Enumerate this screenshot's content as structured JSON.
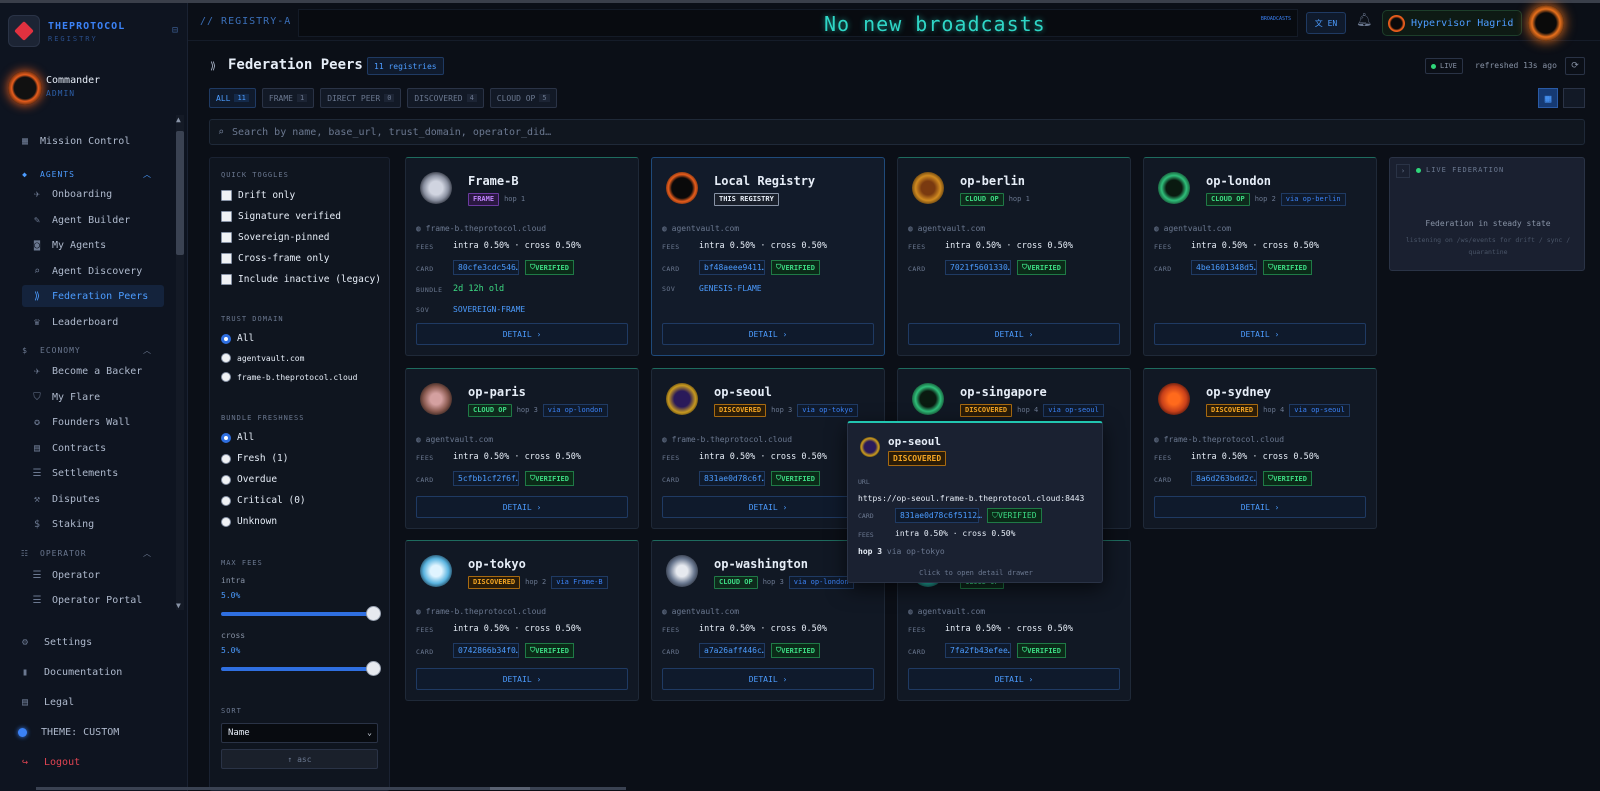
{
  "brand": {
    "name": "THEPROTOCOL",
    "sub": "REGISTRY"
  },
  "user": {
    "name": "Commander",
    "role": "ADMIN"
  },
  "nav": {
    "mission": "Mission Control",
    "agents_sec": "AGENTS",
    "onboarding": "Onboarding",
    "builder": "Agent Builder",
    "my_agents": "My Agents",
    "discovery": "Agent Discovery",
    "federation": "Federation Peers",
    "leaderboard": "Leaderboard",
    "economy_sec": "ECONOMY",
    "backer": "Become a Backer",
    "flare": "My Flare",
    "founders": "Founders Wall",
    "contracts": "Contracts",
    "settlements": "Settlements",
    "disputes": "Disputes",
    "staking": "Staking",
    "operator_sec": "OPERATOR",
    "operator": "Operator",
    "portal": "Operator Portal",
    "settings": "Settings",
    "docs": "Documentation",
    "legal": "Legal",
    "theme": "THEME: CUSTOM",
    "logout": "Logout"
  },
  "header": {
    "crumb": "// REGISTRY-A",
    "ticker": "No new broadcasts",
    "ticker_tag": "BROADCASTS",
    "lang": "文 EN",
    "user": "Hypervisor Hagrid"
  },
  "page": {
    "title": "Federation Peers",
    "count": "11 registries",
    "live": "LIVE",
    "refreshed": "refreshed 13s ago"
  },
  "tabs": [
    {
      "label": "ALL",
      "n": "11"
    },
    {
      "label": "FRAME",
      "n": "1"
    },
    {
      "label": "DIRECT PEER",
      "n": "0"
    },
    {
      "label": "DISCOVERED",
      "n": "4"
    },
    {
      "label": "CLOUD OP",
      "n": "5"
    }
  ],
  "search": {
    "placeholder": "Search by name, base_url, trust_domain, operator_did…"
  },
  "filters": {
    "quick": "QUICK TOGGLES",
    "drift": "Drift only",
    "sig": "Signature verified",
    "sov": "Sovereign-pinned",
    "cross": "Cross-frame only",
    "inactive": "Include inactive (legacy)",
    "trust": "TRUST DOMAIN",
    "t_all": "All",
    "t_av": "agentvault.com",
    "t_fb": "frame-b.theprotocol.cloud",
    "bundle": "BUNDLE FRESHNESS",
    "b_all": "All",
    "b_fresh": "Fresh (1)",
    "b_over": "Overdue",
    "b_crit": "Critical (0)",
    "b_unk": "Unknown",
    "maxfees": "MAX FEES",
    "intra": "intra",
    "intra_val": "5.0%",
    "cross_lab": "cross",
    "cross_val": "5.0%",
    "intra_level": 1.0,
    "cross_level": 1.0,
    "sort": "SORT",
    "sort_val": "Name",
    "asc": "↑ asc"
  },
  "cards": [
    {
      "name": "Frame-B",
      "tag": "FRAME",
      "hop": "hop 1",
      "via": "",
      "host": "frame-b.theprotocol.cloud",
      "fees": "intra 0.50% · cross 0.50%",
      "card": "80cfe3cdc546…",
      "verified": "VERIFIED",
      "bundle": "2d 12h old",
      "sov": "SOVEREIGN-FRAME"
    },
    {
      "name": "Local Registry",
      "tag": "THIS REGISTRY",
      "hop": "",
      "via": "",
      "host": "agentvault.com",
      "fees": "intra 0.50% · cross 0.50%",
      "card": "bf48aeee9411…",
      "verified": "VERIFIED",
      "sov": "GENESIS-FLAME"
    },
    {
      "name": "op-berlin",
      "tag": "CLOUD OP",
      "hop": "hop 1",
      "via": "",
      "host": "agentvault.com",
      "fees": "intra 0.50% · cross 0.50%",
      "card": "7021f5601330…",
      "verified": "VERIFIED"
    },
    {
      "name": "op-london",
      "tag": "CLOUD OP",
      "hop": "hop 2",
      "via": "via op-berlin",
      "host": "agentvault.com",
      "fees": "intra 0.50% · cross 0.50%",
      "card": "4be1601348d5…",
      "verified": "VERIFIED"
    },
    {
      "name": "op-paris",
      "tag": "CLOUD OP",
      "hop": "hop 3",
      "via": "via op-london",
      "host": "agentvault.com",
      "fees": "intra 0.50% · cross 0.50%",
      "card": "5cfbb1cf2f6f…",
      "verified": "VERIFIED"
    },
    {
      "name": "op-seoul",
      "tag": "DISCOVERED",
      "hop": "hop 3",
      "via": "via op-tokyo",
      "host": "frame-b.theprotocol.cloud",
      "fees": "intra 0.50% · cross 0.50%",
      "card": "831ae0d78c6f…",
      "verified": "VERIFIED"
    },
    {
      "name": "op-singapore",
      "tag": "DISCOVERED",
      "hop": "hop 4",
      "via": "via op-seoul"
    },
    {
      "name": "op-sydney",
      "tag": "DISCOVERED",
      "hop": "hop 4",
      "via": "via op-seoul",
      "host": "frame-b.theprotocol.cloud",
      "fees": "intra 0.50% · cross 0.50%",
      "card": "8a6d263bdd2c…",
      "verified": "VERIFIED"
    },
    {
      "name": "op-tokyo",
      "tag": "DISCOVERED",
      "hop": "hop 2",
      "via": "via Frame-B",
      "host": "frame-b.theprotocol.cloud",
      "fees": "intra 0.50% · cross 0.50%",
      "card": "0742866b34f0…",
      "verified": "VERIFIED"
    },
    {
      "name": "op-washington",
      "tag": "CLOUD OP",
      "hop": "hop 3",
      "via": "via op-london",
      "host": "agentvault.com",
      "fees": "intra 0.50% · cross 0.50%",
      "card": "a7a26aff446c…",
      "verified": "VERIFIED"
    },
    {
      "name": "",
      "tag": "CLOUD OP",
      "hop": "",
      "via": "",
      "host": "agentvault.com",
      "fees": "intra 0.50% · cross 0.50%",
      "card": "7fa2fb43efee…",
      "verified": "VERIFIED"
    }
  ],
  "labels": {
    "fees": "FEES",
    "card": "CARD",
    "bundle": "BUNDLE",
    "sov": "SOV",
    "detail": "DETAIL ›"
  },
  "livefed": {
    "title": "LIVE FEDERATION",
    "main": "Federation in steady state",
    "sub": "listening on /ws/events for drift / sync / quarantine"
  },
  "tooltip": {
    "name": "op-seoul",
    "tag": "DISCOVERED",
    "url_lab": "URL",
    "url": "https://op-seoul.frame-b.theprotocol.cloud:8443",
    "card_lab": "CARD",
    "card": "831ae0d78c6f5112…",
    "verified": "VERIFIED",
    "fees_lab": "FEES",
    "fees": "intra 0.50% · cross 0.50%",
    "hop": "hop 3",
    "via": "via op-tokyo",
    "foot": "Click to open detail drawer"
  }
}
